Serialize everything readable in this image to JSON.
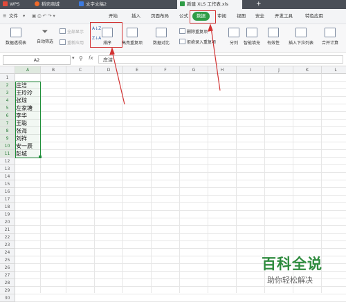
{
  "tabs": [
    {
      "label": "WPS"
    },
    {
      "label": "稻壳商城"
    },
    {
      "label": "文字文稿2"
    },
    {
      "label": "新建 XLS 工作表.xls"
    }
  ],
  "tab_add": "+",
  "file_menu": "文件",
  "menus": [
    "开始",
    "插入",
    "页面布局",
    "公式",
    "数据",
    "审阅",
    "视图",
    "安全",
    "开发工具",
    "特色应用"
  ],
  "toolbar": {
    "pivot": "数据透视表",
    "autofilter": "自动筛选",
    "show_all": "全部显示",
    "reapply": "重新应用",
    "sort": "排序",
    "highlight_dup": "高亮重复项",
    "data_compare": "数据对比",
    "remove_dup": "删除重复项",
    "reject_dup": "拒绝录入重复项",
    "split": "分列",
    "smart_fill": "智能填充",
    "validity": "有效性",
    "dropdown": "插入下拉列表",
    "consolidate": "合并计算"
  },
  "sort_icon_top": "A↓Z",
  "sort_icon_bottom": "Z↓A",
  "name_box": "A2",
  "formula_fx": "fx",
  "formula_value": "庄洁",
  "columns": [
    "A",
    "B",
    "C",
    "D",
    "E",
    "F",
    "G",
    "H",
    "I",
    "J",
    "K",
    "L"
  ],
  "rows": [
    "1",
    "2",
    "3",
    "4",
    "5",
    "6",
    "7",
    "8",
    "9",
    "10",
    "11",
    "12",
    "13",
    "14",
    "15",
    "16",
    "17",
    "18",
    "19",
    "20",
    "21",
    "22",
    "23",
    "24",
    "25",
    "26",
    "27",
    "28",
    "29",
    "30"
  ],
  "cells_a": [
    "",
    "庄洁",
    "王玲玲",
    "张琼",
    "左家塘",
    "李华",
    "王聪",
    "张海",
    "刘祥",
    "安一辰",
    "彭城"
  ],
  "watermark": {
    "title": "百科全说",
    "subtitle": "助你轻松解决"
  },
  "colors": {
    "tabbar": "#4a4f57",
    "data_tab": "#2f9c46",
    "annotation": "#d23232",
    "selection": "#1f8f3a"
  }
}
